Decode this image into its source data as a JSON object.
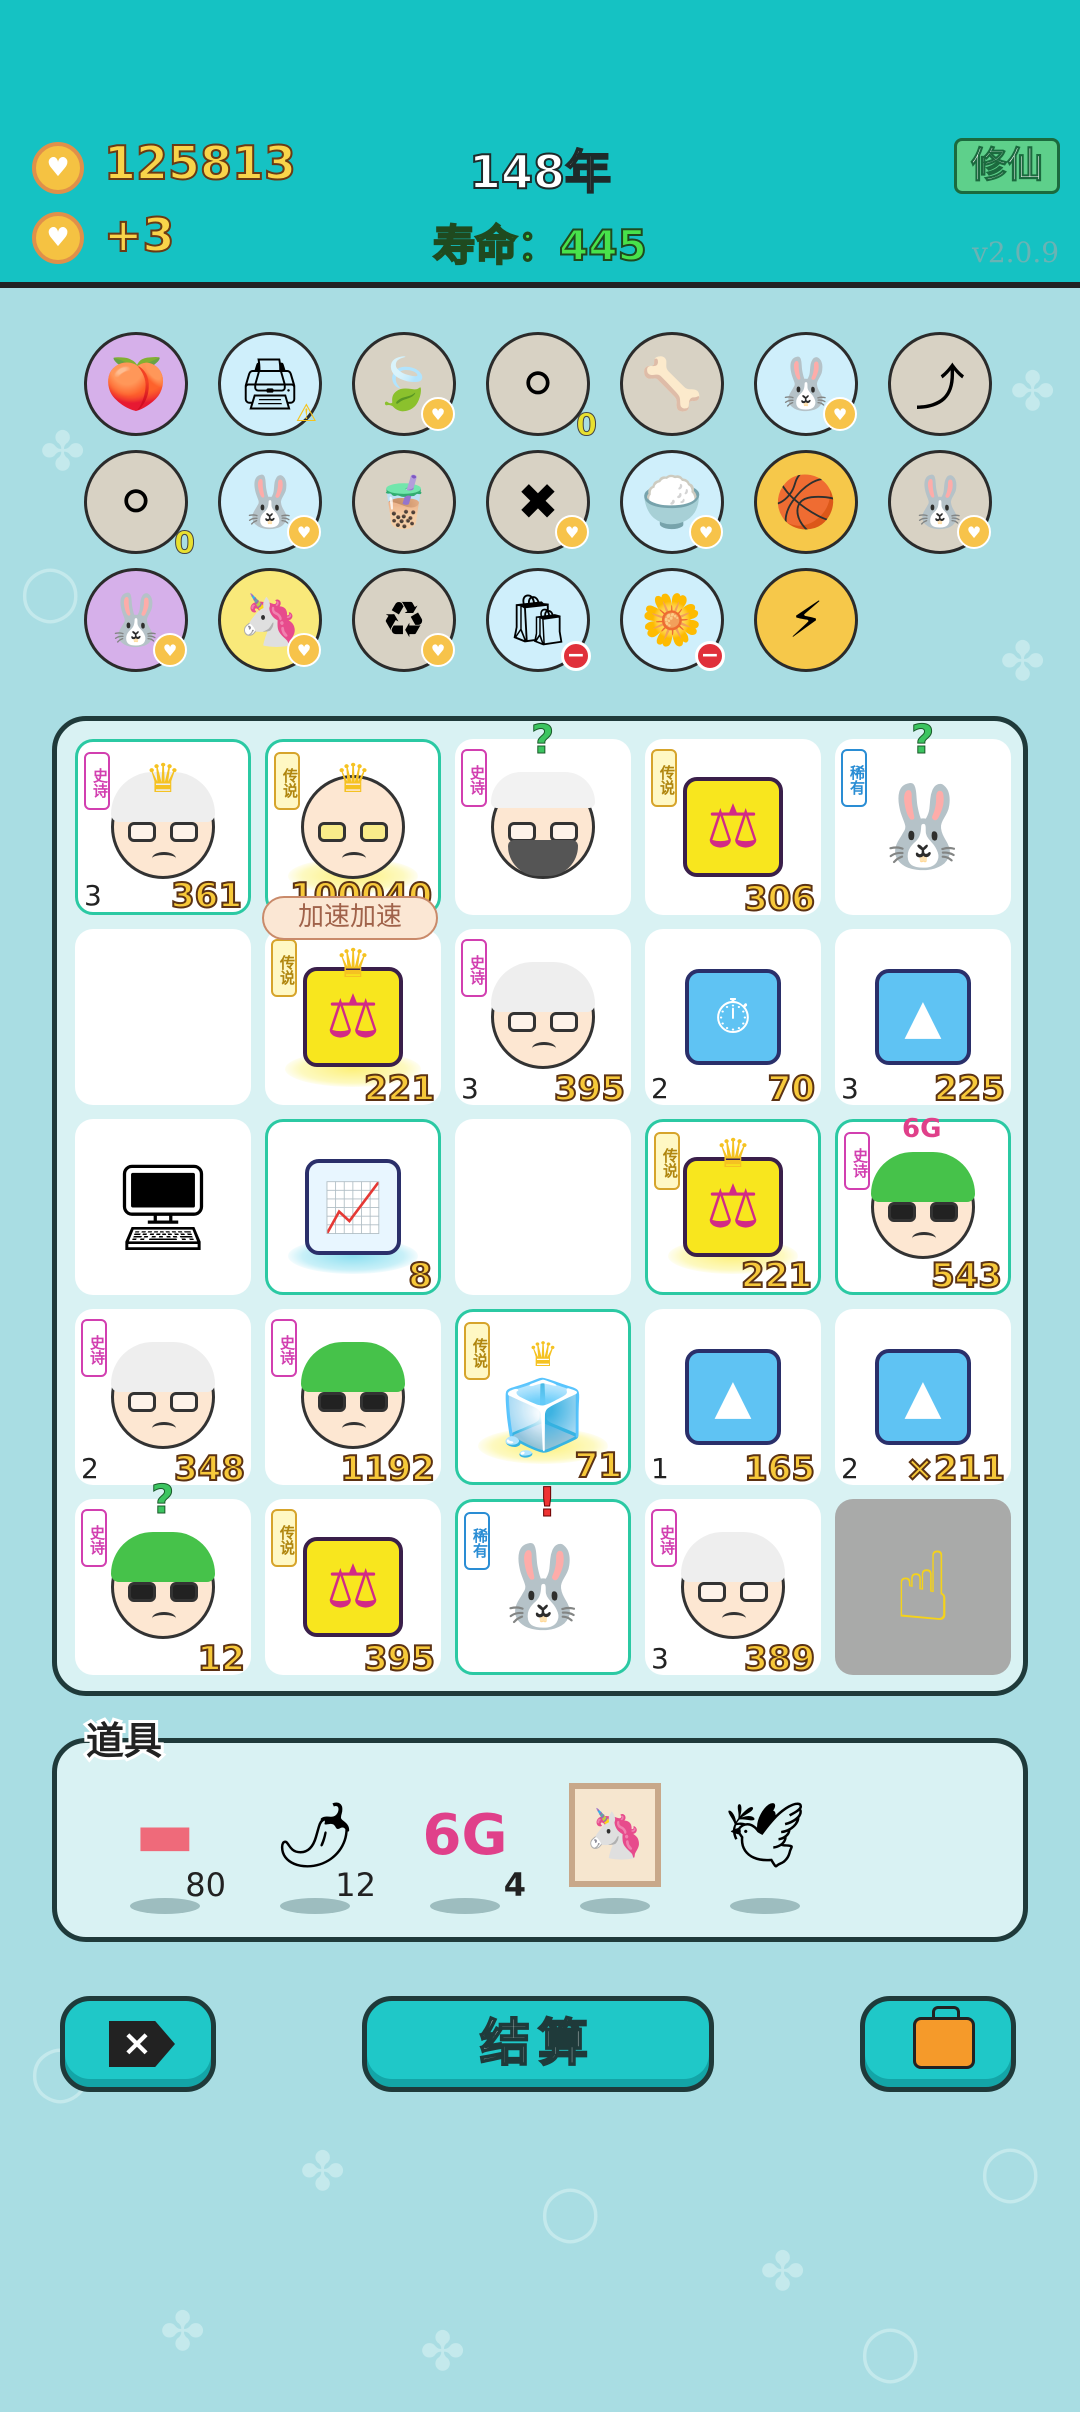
{
  "header": {
    "coins": "125813",
    "income": "+3",
    "year": "148年",
    "lifespan_label": "寿命：",
    "lifespan_value": "445",
    "xiuxian_label": "修仙",
    "version": "v2.0.9",
    "coin_icon": "heart-coin-icon"
  },
  "tools": {
    "badge_zero_1": "0",
    "badge_zero_2": "0",
    "items": [
      {
        "icon": "sunglasses-fruit-icon"
      },
      {
        "icon": "printer-icon"
      },
      {
        "icon": "leaf-icon"
      },
      {
        "icon": "egg-tray-icon"
      },
      {
        "icon": "dog-bowl-icon"
      },
      {
        "icon": "bunny-icon"
      },
      {
        "icon": "arrow-card-icon"
      },
      {
        "icon": "egg-tray-icon"
      },
      {
        "icon": "bunny-icon"
      },
      {
        "icon": "milk-tea-icon"
      },
      {
        "icon": "close-tag-icon"
      },
      {
        "icon": "rice-bowl-icon"
      },
      {
        "icon": "basketballs-icon"
      },
      {
        "icon": "bunny-icon"
      },
      {
        "icon": "bunny-icon"
      },
      {
        "icon": "unicorn-icon"
      },
      {
        "icon": "refresh-icon"
      },
      {
        "icon": "sack-icon"
      },
      {
        "icon": "flower-pot-icon"
      },
      {
        "icon": "lightning-icon"
      }
    ]
  },
  "board": {
    "speed_bubble": "加速加速",
    "tags": {
      "epic": "史诗",
      "legend": "传说",
      "rare": "稀有"
    },
    "cells": [
      {
        "count": "3",
        "value": "361"
      },
      {
        "count": "",
        "value": "100040"
      },
      {
        "count": "",
        "value": ""
      },
      {
        "count": "",
        "value": "306"
      },
      {
        "count": "",
        "value": ""
      },
      {
        "count": "",
        "value": ""
      },
      {
        "count": "",
        "value": "221"
      },
      {
        "count": "3",
        "value": "395"
      },
      {
        "count": "2",
        "value": "70"
      },
      {
        "count": "3",
        "value": "225"
      },
      {
        "count": "",
        "value": ""
      },
      {
        "count": "",
        "value": "8"
      },
      {
        "count": "",
        "value": ""
      },
      {
        "count": "",
        "value": "221"
      },
      {
        "count": "",
        "value": "543"
      },
      {
        "count": "2",
        "value": "348"
      },
      {
        "count": "",
        "value": "1192"
      },
      {
        "count": "",
        "value": "71"
      },
      {
        "count": "1",
        "value": "165"
      },
      {
        "count": "2",
        "value": "×211"
      },
      {
        "count": "",
        "value": "12"
      },
      {
        "count": "",
        "value": "395"
      },
      {
        "count": "",
        "value": ""
      },
      {
        "count": "3",
        "value": "389"
      },
      {
        "count": "",
        "value": ""
      }
    ],
    "sixg_label": "6G",
    "question_mark": "?",
    "exclamation": "!"
  },
  "props": {
    "title": "道具",
    "items": [
      {
        "icon": "liver-icon",
        "count": "80"
      },
      {
        "icon": "chili-pepper-icon",
        "count": "12"
      },
      {
        "icon": "6g-icon",
        "label": "6G",
        "count": "4"
      },
      {
        "icon": "unicorn-frame-icon",
        "count": ""
      },
      {
        "icon": "pigeon-icon",
        "count": ""
      }
    ]
  },
  "buttons": {
    "close_label": "×",
    "settle_label": "结算",
    "bag_icon": "briefcase-icon"
  }
}
